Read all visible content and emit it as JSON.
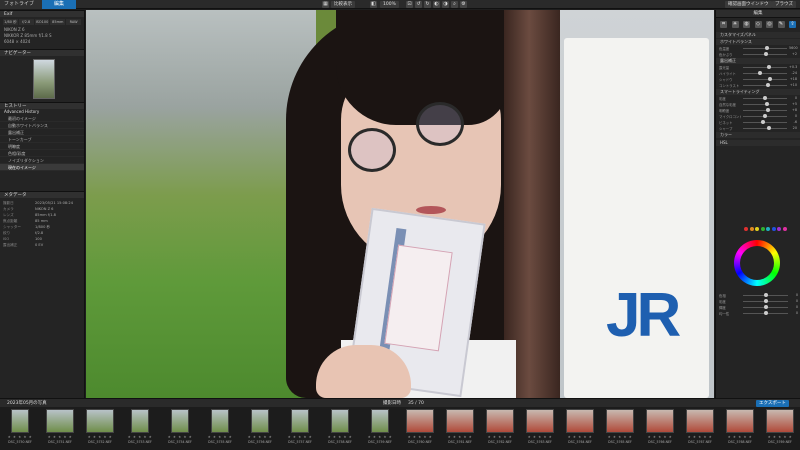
{
  "topbar": {
    "tabs": [
      "フォトライブラリ",
      "編集"
    ],
    "compare_label": "比較表示",
    "zoom_label": "100%",
    "right_buttons": [
      "確認画面ウインドウ",
      "ブラウズ"
    ]
  },
  "left_panel": {
    "section1_title": "Exif",
    "exif_cells": [
      "1/80 秒",
      "f/2.8",
      "ISO100",
      "85mm",
      "RAW"
    ],
    "camera_line": "NIKON Z 6",
    "lens_line": "NIKKOR Z 85mm f/1.8 S",
    "size_line": "6048 × 4024",
    "navigator_title": "ナビゲーター",
    "history_title": "ヒストリー",
    "history_sub": "Advanced History",
    "history_items": [
      "最初のイメージ",
      "自動ホワイトバランス",
      "露出補正",
      "トーンカーブ",
      "明瞭度",
      "色相/彩度",
      "ノイズリダクション",
      "現在のイメージ"
    ],
    "metadata_title": "メタデータ",
    "exif_rows": [
      {
        "k": "撮影日",
        "v": "2023/05/21 15:08:24"
      },
      {
        "k": "カメラ",
        "v": "NIKON Z 6"
      },
      {
        "k": "レンズ",
        "v": "85mm f/1.8"
      },
      {
        "k": "焦点距離",
        "v": "85 mm"
      },
      {
        "k": "シャッター",
        "v": "1/800 秒"
      },
      {
        "k": "絞り",
        "v": "f/2.8"
      },
      {
        "k": "ISO",
        "v": "100"
      },
      {
        "k": "露出補正",
        "v": "0 EV"
      }
    ]
  },
  "right_panel": {
    "header": "編集",
    "icons": [
      "crop-icon",
      "light-icon",
      "color-icon",
      "detail-icon",
      "lens-icon",
      "local-icon",
      "export-icon"
    ],
    "sections": [
      "カスタマイズパネル",
      "ホワイトバランス",
      "露出補正",
      "スマートライティング",
      "カラー",
      "HSL"
    ],
    "sliders": [
      {
        "label": "色温度",
        "val": "5600",
        "pos": 55
      },
      {
        "label": "色かぶり",
        "val": "+2",
        "pos": 52
      },
      {
        "label": "露光量",
        "val": "+0.3",
        "pos": 60
      },
      {
        "label": "ハイライト",
        "val": "-24",
        "pos": 38
      },
      {
        "label": "シャドウ",
        "val": "+18",
        "pos": 62
      },
      {
        "label": "コントラスト",
        "val": "+10",
        "pos": 56
      },
      {
        "label": "彩度",
        "val": "0",
        "pos": 50
      },
      {
        "label": "自然な彩度",
        "val": "+5",
        "pos": 54
      },
      {
        "label": "明瞭度",
        "val": "+8",
        "pos": 57
      },
      {
        "label": "マイクロコントラスト",
        "val": "0",
        "pos": 50
      },
      {
        "label": "ビネット",
        "val": "-6",
        "pos": 45
      },
      {
        "label": "シャープ",
        "val": "20",
        "pos": 58
      }
    ],
    "hsl_sliders": [
      {
        "label": "色相",
        "val": "0",
        "pos": 50
      },
      {
        "label": "彩度",
        "val": "0",
        "pos": 50
      },
      {
        "label": "輝度",
        "val": "0",
        "pos": 50
      },
      {
        "label": "均一性",
        "val": "0",
        "pos": 50
      }
    ],
    "dot_colors": [
      "#e03030",
      "#e08a20",
      "#e0d020",
      "#30b030",
      "#20b0c0",
      "#2050e0",
      "#a030d0",
      "#e030a0"
    ]
  },
  "filmstrip": {
    "path_label": "2023年05月の写真",
    "sort_label": "撮影日時",
    "count_label": "35 / 70",
    "export_label": "エクスポート",
    "items": [
      {
        "name": "DSC_5750.NEF",
        "kind": "port"
      },
      {
        "name": "DSC_5751.NEF",
        "kind": ""
      },
      {
        "name": "DSC_5752.NEF",
        "kind": ""
      },
      {
        "name": "DSC_5753.NEF",
        "kind": "port"
      },
      {
        "name": "DSC_5754.NEF",
        "kind": "port"
      },
      {
        "name": "DSC_5755.NEF",
        "kind": "port"
      },
      {
        "name": "DSC_5756.NEF",
        "kind": "port"
      },
      {
        "name": "DSC_5757.NEF",
        "kind": "port"
      },
      {
        "name": "DSC_5758.NEF",
        "kind": "port"
      },
      {
        "name": "DSC_5759.NEF",
        "kind": "port"
      },
      {
        "name": "DSC_5760.NEF",
        "kind": "red"
      },
      {
        "name": "DSC_5761.NEF",
        "kind": "red"
      },
      {
        "name": "DSC_5762.NEF",
        "kind": "red"
      },
      {
        "name": "DSC_5763.NEF",
        "kind": "red"
      },
      {
        "name": "DSC_5764.NEF",
        "kind": "red"
      },
      {
        "name": "DSC_5765.NEF",
        "kind": "red"
      },
      {
        "name": "DSC_5766.NEF",
        "kind": "red"
      },
      {
        "name": "DSC_5767.NEF",
        "kind": "red"
      },
      {
        "name": "DSC_5768.NEF",
        "kind": "red"
      },
      {
        "name": "DSC_5769.NEF",
        "kind": "red"
      }
    ]
  }
}
